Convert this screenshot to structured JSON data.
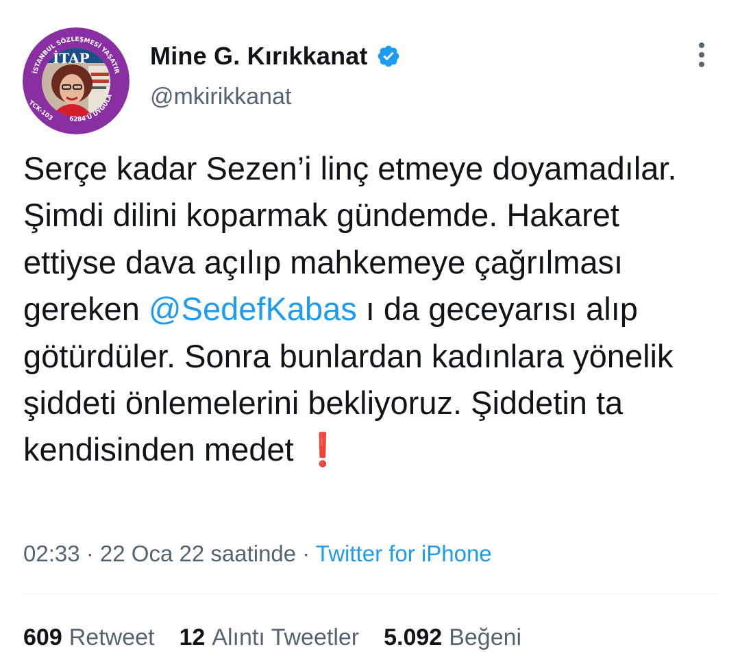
{
  "author": {
    "name": "Mine G. Kırıkkanat",
    "handle": "@mkirikkanat",
    "avatar_banner_top": "İSTANBUL SÖZLEŞMESİ YAŞATIR",
    "avatar_banner_left": "TCK-103",
    "avatar_banner_bottom": "6284'Ü UYGULA",
    "avatar_sign": "İTAP"
  },
  "tweet": {
    "text_before_mention": "Serçe kadar Sezen’i linç etmeye doyamadılar. Şimdi dilini koparmak gündemde. Hakaret ettiyse dava açılıp mahkemeye çağrılması gereken ",
    "mention": "@SedefKabas",
    "text_after_mention": " ı da geceyarısı alıp götürdüler. Sonra bunlardan kadınlara yönelik şiddeti önlemelerini bekliyoruz. Şiddetin ta kendisinden medet ",
    "emoji": "❗"
  },
  "meta": {
    "time": "02:33",
    "separator": " · ",
    "date": "22 Oca 22 saatinde",
    "separator2": " · ",
    "source": "Twitter for iPhone"
  },
  "stats": {
    "retweets_count": "609",
    "retweets_label": "Retweet",
    "quotes_count": "12",
    "quotes_label": "Alıntı Tweetler",
    "likes_count": "5.092",
    "likes_label": "Beğeni"
  },
  "icons": {
    "verified": "verified-badge-icon",
    "more": "more-vertical-icon"
  },
  "colors": {
    "accent": "#1d9bf0",
    "secondary_text": "#536471",
    "avatar_ring": "#8a2fa1",
    "exclaim": "#e0201d"
  }
}
